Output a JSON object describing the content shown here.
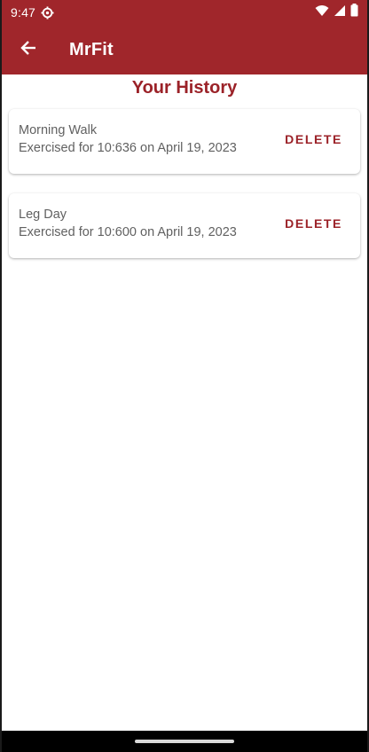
{
  "status_bar": {
    "time": "9:47",
    "icons": [
      "settings-gear-icon",
      "wifi-icon",
      "signal-icon",
      "battery-icon"
    ]
  },
  "app_bar": {
    "title": "MrFit",
    "back_icon": "arrow-back-icon"
  },
  "page": {
    "heading": "Your History"
  },
  "history": [
    {
      "name": "Morning Walk",
      "detail": "Exercised for 10:636 on April 19, 2023",
      "action": "DELETE"
    },
    {
      "name": "Leg Day",
      "detail": "Exercised for 10:600 on April 19, 2023",
      "action": "DELETE"
    }
  ],
  "colors": {
    "primary": "#a0262b",
    "accent_text": "#9b2228",
    "secondary_text": "#616161"
  }
}
